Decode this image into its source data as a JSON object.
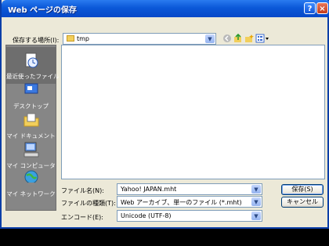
{
  "window": {
    "title": "Web ページの保存",
    "help_label": "?",
    "close_label": "×"
  },
  "save_in": {
    "label": "保存する場所(I):",
    "value": "tmp"
  },
  "places": [
    {
      "label": "最近使ったファイル",
      "icon": "recent-documents-icon"
    },
    {
      "label": "デスクトップ",
      "icon": "desktop-icon"
    },
    {
      "label": "マイ ドキュメント",
      "icon": "my-documents-icon"
    },
    {
      "label": "マイ コンピュータ",
      "icon": "my-computer-icon"
    },
    {
      "label": "マイ ネットワーク",
      "icon": "my-network-icon"
    }
  ],
  "filename": {
    "label": "ファイル名(N):",
    "value": "Yahoo! JAPAN.mht"
  },
  "filetype": {
    "label": "ファイルの種類(T):",
    "value": "Web アーカイブ、単一のファイル (*.mht)"
  },
  "encoding": {
    "label": "エンコード(E):",
    "value": "Unicode (UTF-8)"
  },
  "buttons": {
    "save": "保存(S)",
    "cancel": "キャンセル"
  },
  "colors": {
    "titlebar": "#0b58d8",
    "dialog_bg": "#ece9d8",
    "sidebar_bg": "#868686"
  }
}
